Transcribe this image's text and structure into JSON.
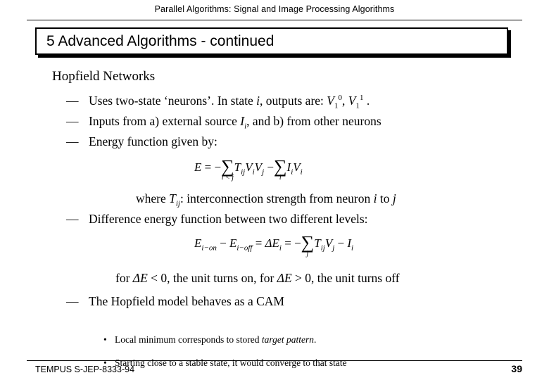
{
  "header": {
    "running_title": "Parallel Algorithms:  Signal and Image Processing Algorithms"
  },
  "title": {
    "text": "5 Advanced Algorithms - continued"
  },
  "content": {
    "subheading": "Hopfield Networks",
    "dash": "—",
    "bullets": [
      "Uses two-state ‘neurons’. In state i, outputs are:  V₁⁰, V₁¹ .",
      "Inputs from a) external source Iᵢ, and b) from other neurons",
      "Energy function given by:",
      "Difference energy function between two different levels:",
      "The Hopfield model behaves as a CAM"
    ],
    "bullet1_parts": {
      "pre": "Uses two-state ‘neurons’. In state ",
      "i": "i",
      "mid": ", outputs are:  ",
      "v1": "V",
      "v1_sub": "1",
      "v1_sup": "0",
      "comma": ", ",
      "v2": "V",
      "v2_sub": "1",
      "v2_sup": "1",
      "post": " ."
    },
    "bullet2_parts": {
      "pre": "Inputs from a) external source ",
      "I": "I",
      "I_sub": "i",
      "post": ", and b) from other neurons"
    },
    "equation1": {
      "lhs": "E",
      "eq": "=",
      "minus": "−",
      "sum1_symbol": "∑",
      "sum1_limit": "i < j",
      "term1": "T",
      "term1_sub": "ij",
      "term1b": "V",
      "term1b_sub": "i",
      "term1c": "V",
      "term1c_sub": "j",
      "minus2": "−",
      "sum2_symbol": "∑",
      "sum2_limit": "i",
      "term2": "I",
      "term2_sub": "i",
      "term2b": "V",
      "term2b_sub": "i",
      "plain": "E = − ∑(i<j) Tij Vi Vj − ∑(i) Ii Vi"
    },
    "where_line": {
      "where": "where ",
      "T": "T",
      "T_sub": "ij",
      "mid": ": interconnection strength from neuron ",
      "i": "i",
      "to": " to ",
      "j": "j"
    },
    "equation2": {
      "plain": "E i−on − E i−off = ΔE i = − ∑(j) Tij Vj − Ii",
      "e1": "E",
      "e1_sub": "i−on",
      "minus": "−",
      "e2": "E",
      "e2_sub": "i−off",
      "eq1": "=",
      "delta": "Δ",
      "e3": "E",
      "e3_sub": "i",
      "eq2": "=",
      "minus2": "−",
      "sum_symbol": "∑",
      "sum_limit": "j",
      "t": "T",
      "t_sub": "ij",
      "v": "V",
      "v_sub": "j",
      "minus3": "−",
      "i_term": "I",
      "i_term_sub": "i"
    },
    "for_line": {
      "pre": "for ",
      "delta1": "Δ",
      "e1": "E",
      "lt": " < 0, the unit turns on, for ",
      "delta2": "Δ",
      "e2": "E",
      "gt": " > 0, the unit turns off"
    },
    "sub_bullets": [
      {
        "dot": "•",
        "pre": "Local minimum corresponds to stored ",
        "italic": "target pattern",
        "post": "."
      },
      {
        "dot": "•",
        "pre": "Starting close to a stable state, it would converge to that state",
        "italic": "",
        "post": ""
      }
    ]
  },
  "footer": {
    "left": "TEMPUS S-JEP-8333-94",
    "page_number": "39"
  },
  "colors": {
    "text": "#000000",
    "background": "#ffffff",
    "rule": "#000000"
  }
}
